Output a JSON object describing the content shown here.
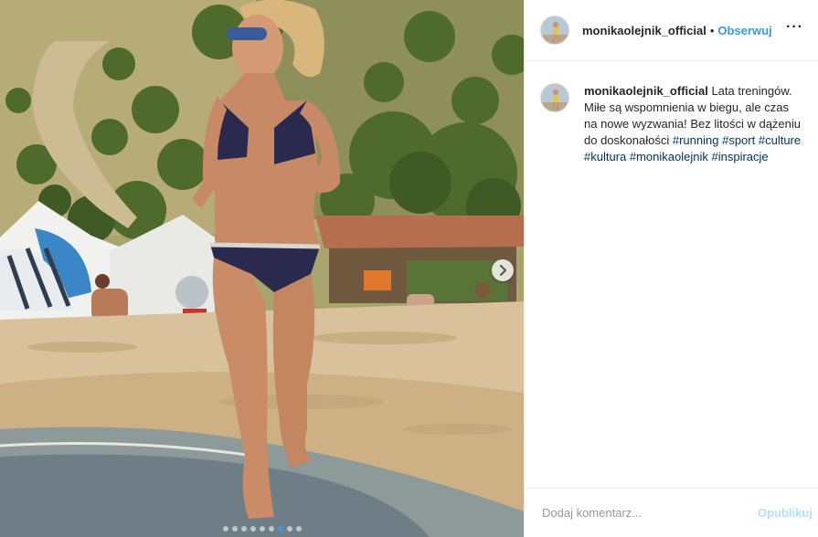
{
  "post": {
    "author": {
      "username": "monikaolejnik_official",
      "avatar_icon": "profile-photo"
    },
    "header": {
      "separator": "•",
      "follow_label": "Obserwuj",
      "more_label": "···"
    },
    "media": {
      "next_icon": "chevron-right-icon",
      "carousel_total": 9,
      "carousel_active_index": 7,
      "colors": {
        "active_dot": "#3897f0",
        "inactive_dot": "#ffffff"
      }
    },
    "caption": {
      "text": "Lata treningów. Miłe są wspomnienia w biegu, ale czas na nowe wyzwania! Bez litości w dążeniu do doskonałości",
      "hashtags": [
        "#running",
        "#sport",
        "#culture",
        "#kultura",
        "#monikaolejnik",
        "#inspiracje"
      ]
    },
    "comment_box": {
      "placeholder": "Dodaj komentarz...",
      "publish_label": "Opublikuj"
    },
    "colors": {
      "link": "#3897f0",
      "hashtag": "#003569",
      "publish_disabled": "#b2dffc",
      "text": "#262626"
    }
  }
}
